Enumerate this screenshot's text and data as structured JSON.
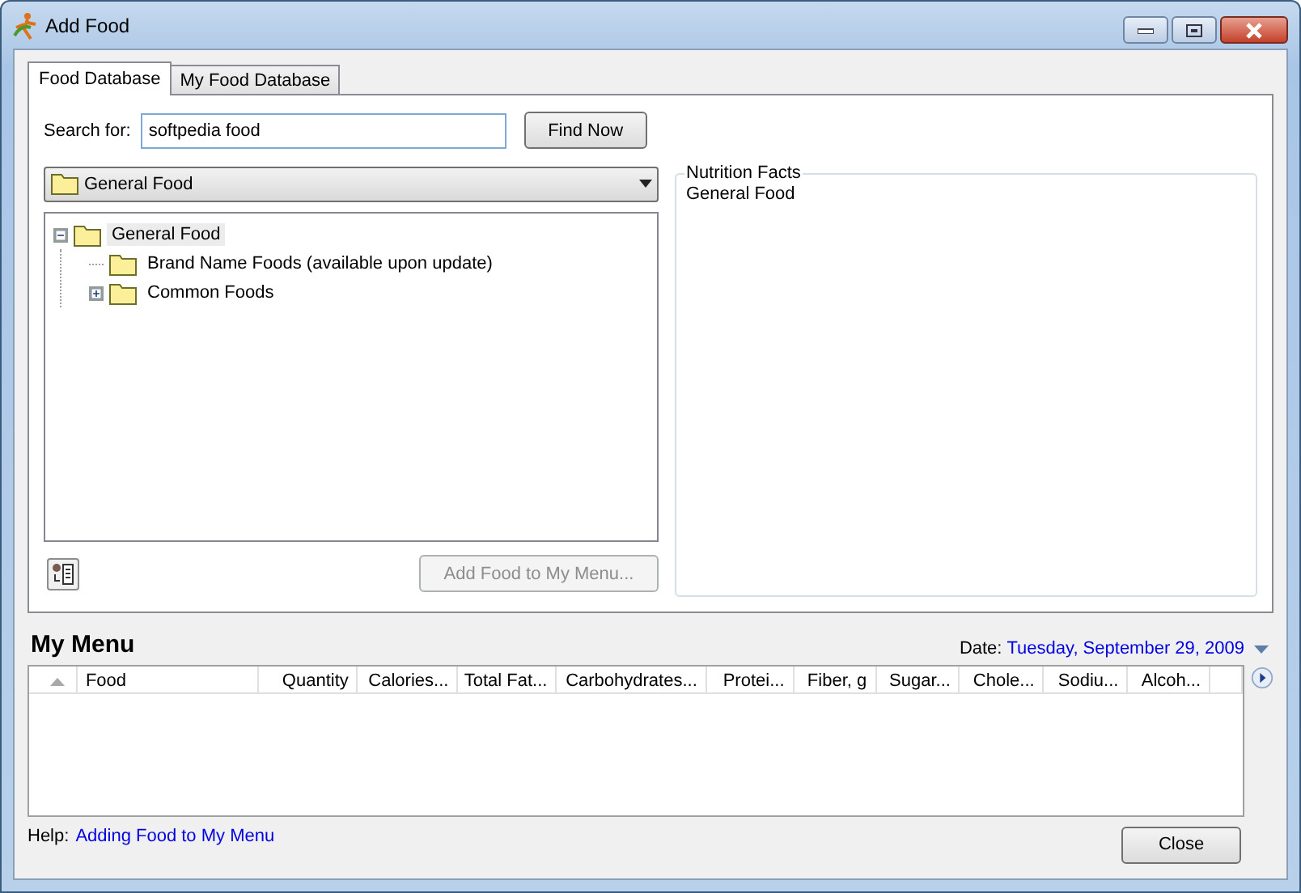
{
  "window": {
    "title": "Add Food"
  },
  "tabs": [
    {
      "label": "Food Database",
      "selected": true
    },
    {
      "label": "My Food Database",
      "selected": false
    }
  ],
  "search": {
    "label": "Search for:",
    "value": "softpedia food",
    "button": "Find Now"
  },
  "category_dropdown": {
    "value": "General Food"
  },
  "tree": [
    {
      "kind": "branch",
      "label": "General Food",
      "expanded": true,
      "selected": true,
      "children": [
        {
          "kind": "leaf",
          "label": "Brand Name Foods (available upon update)",
          "selected": false
        },
        {
          "kind": "branch",
          "label": "Common Foods",
          "expanded": false,
          "selected": false
        }
      ]
    }
  ],
  "add_button": {
    "label": "Add Food to My Menu...",
    "disabled": true
  },
  "nutrition_facts": {
    "title": "Nutrition Facts",
    "text": "General Food"
  },
  "my_menu": {
    "title": "My Menu",
    "date_label": "Date:",
    "date": "Tuesday, September 29, 2009"
  },
  "table": {
    "columns": [
      "",
      "Food",
      "Quantity",
      "Calories...",
      "Total Fat...",
      "Carbohydrates...",
      "Protei...",
      "Fiber, g",
      "Sugar...",
      "Chole...",
      "Sodiu...",
      "Alcoh...",
      ""
    ]
  },
  "help": {
    "label": "Help:",
    "link": "Adding Food to My Menu"
  },
  "buttons": [
    "Close"
  ]
}
